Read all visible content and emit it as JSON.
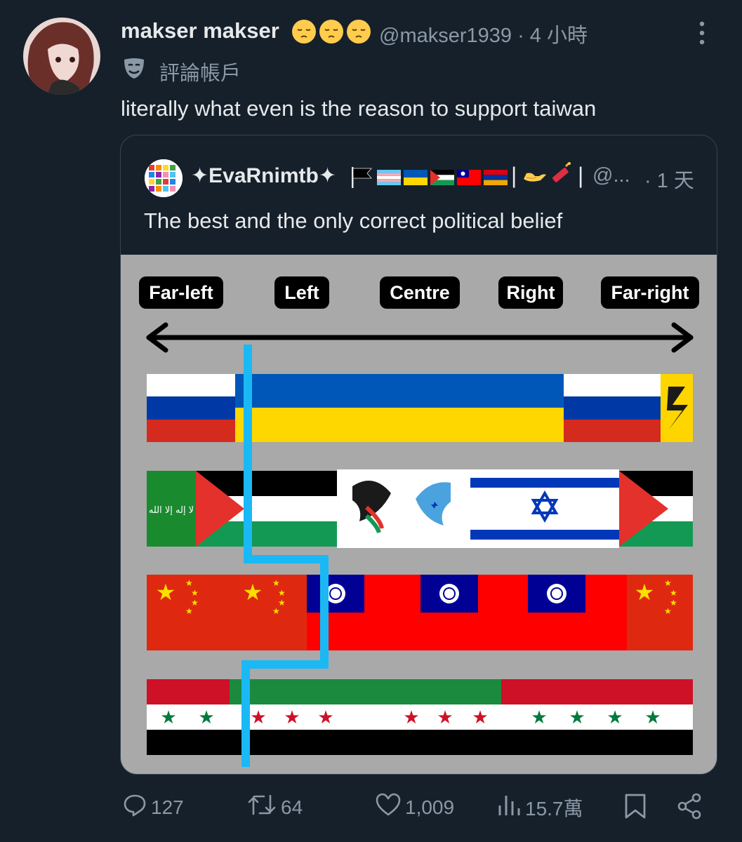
{
  "tweet": {
    "author_name": "makser makser",
    "author_emojis": [
      "😔",
      "😔",
      "😔"
    ],
    "handle": "@makser1939",
    "time": "· 4 小時",
    "account_label": "評論帳戶",
    "text": "literally what even is the reason to support taiwan"
  },
  "quote": {
    "author_name": "✦EvaRnimtb✦",
    "flags": [
      "black-flag",
      "transgender-flag",
      "ukraine-flag",
      "palestine-flag",
      "taiwan-flag",
      "armenia-flag"
    ],
    "separator": "|",
    "emoji": [
      "🫴",
      "🧨"
    ],
    "handle": "@...",
    "time": "· 1 天",
    "text": "The best and the only correct political belief",
    "meme": {
      "labels": [
        "Far-left",
        "Left",
        "Centre",
        "Right",
        "Far-right"
      ],
      "rows": [
        [
          "russia",
          "ukraine",
          "russia",
          "azov"
        ],
        [
          "hamas",
          "palestine",
          "doves",
          "israel",
          "palestine"
        ],
        [
          "china",
          "taiwan",
          "china"
        ],
        [
          "syria-new",
          "syria-old",
          "syria-new"
        ]
      ]
    }
  },
  "actions": {
    "replies": "127",
    "retweets": "64",
    "likes": "1,009",
    "views": "15.7萬"
  },
  "colors": {
    "background": "#15202b",
    "text_secondary": "#8b98a5",
    "border": "#38444d",
    "line_blue": "#1ab9f5"
  }
}
